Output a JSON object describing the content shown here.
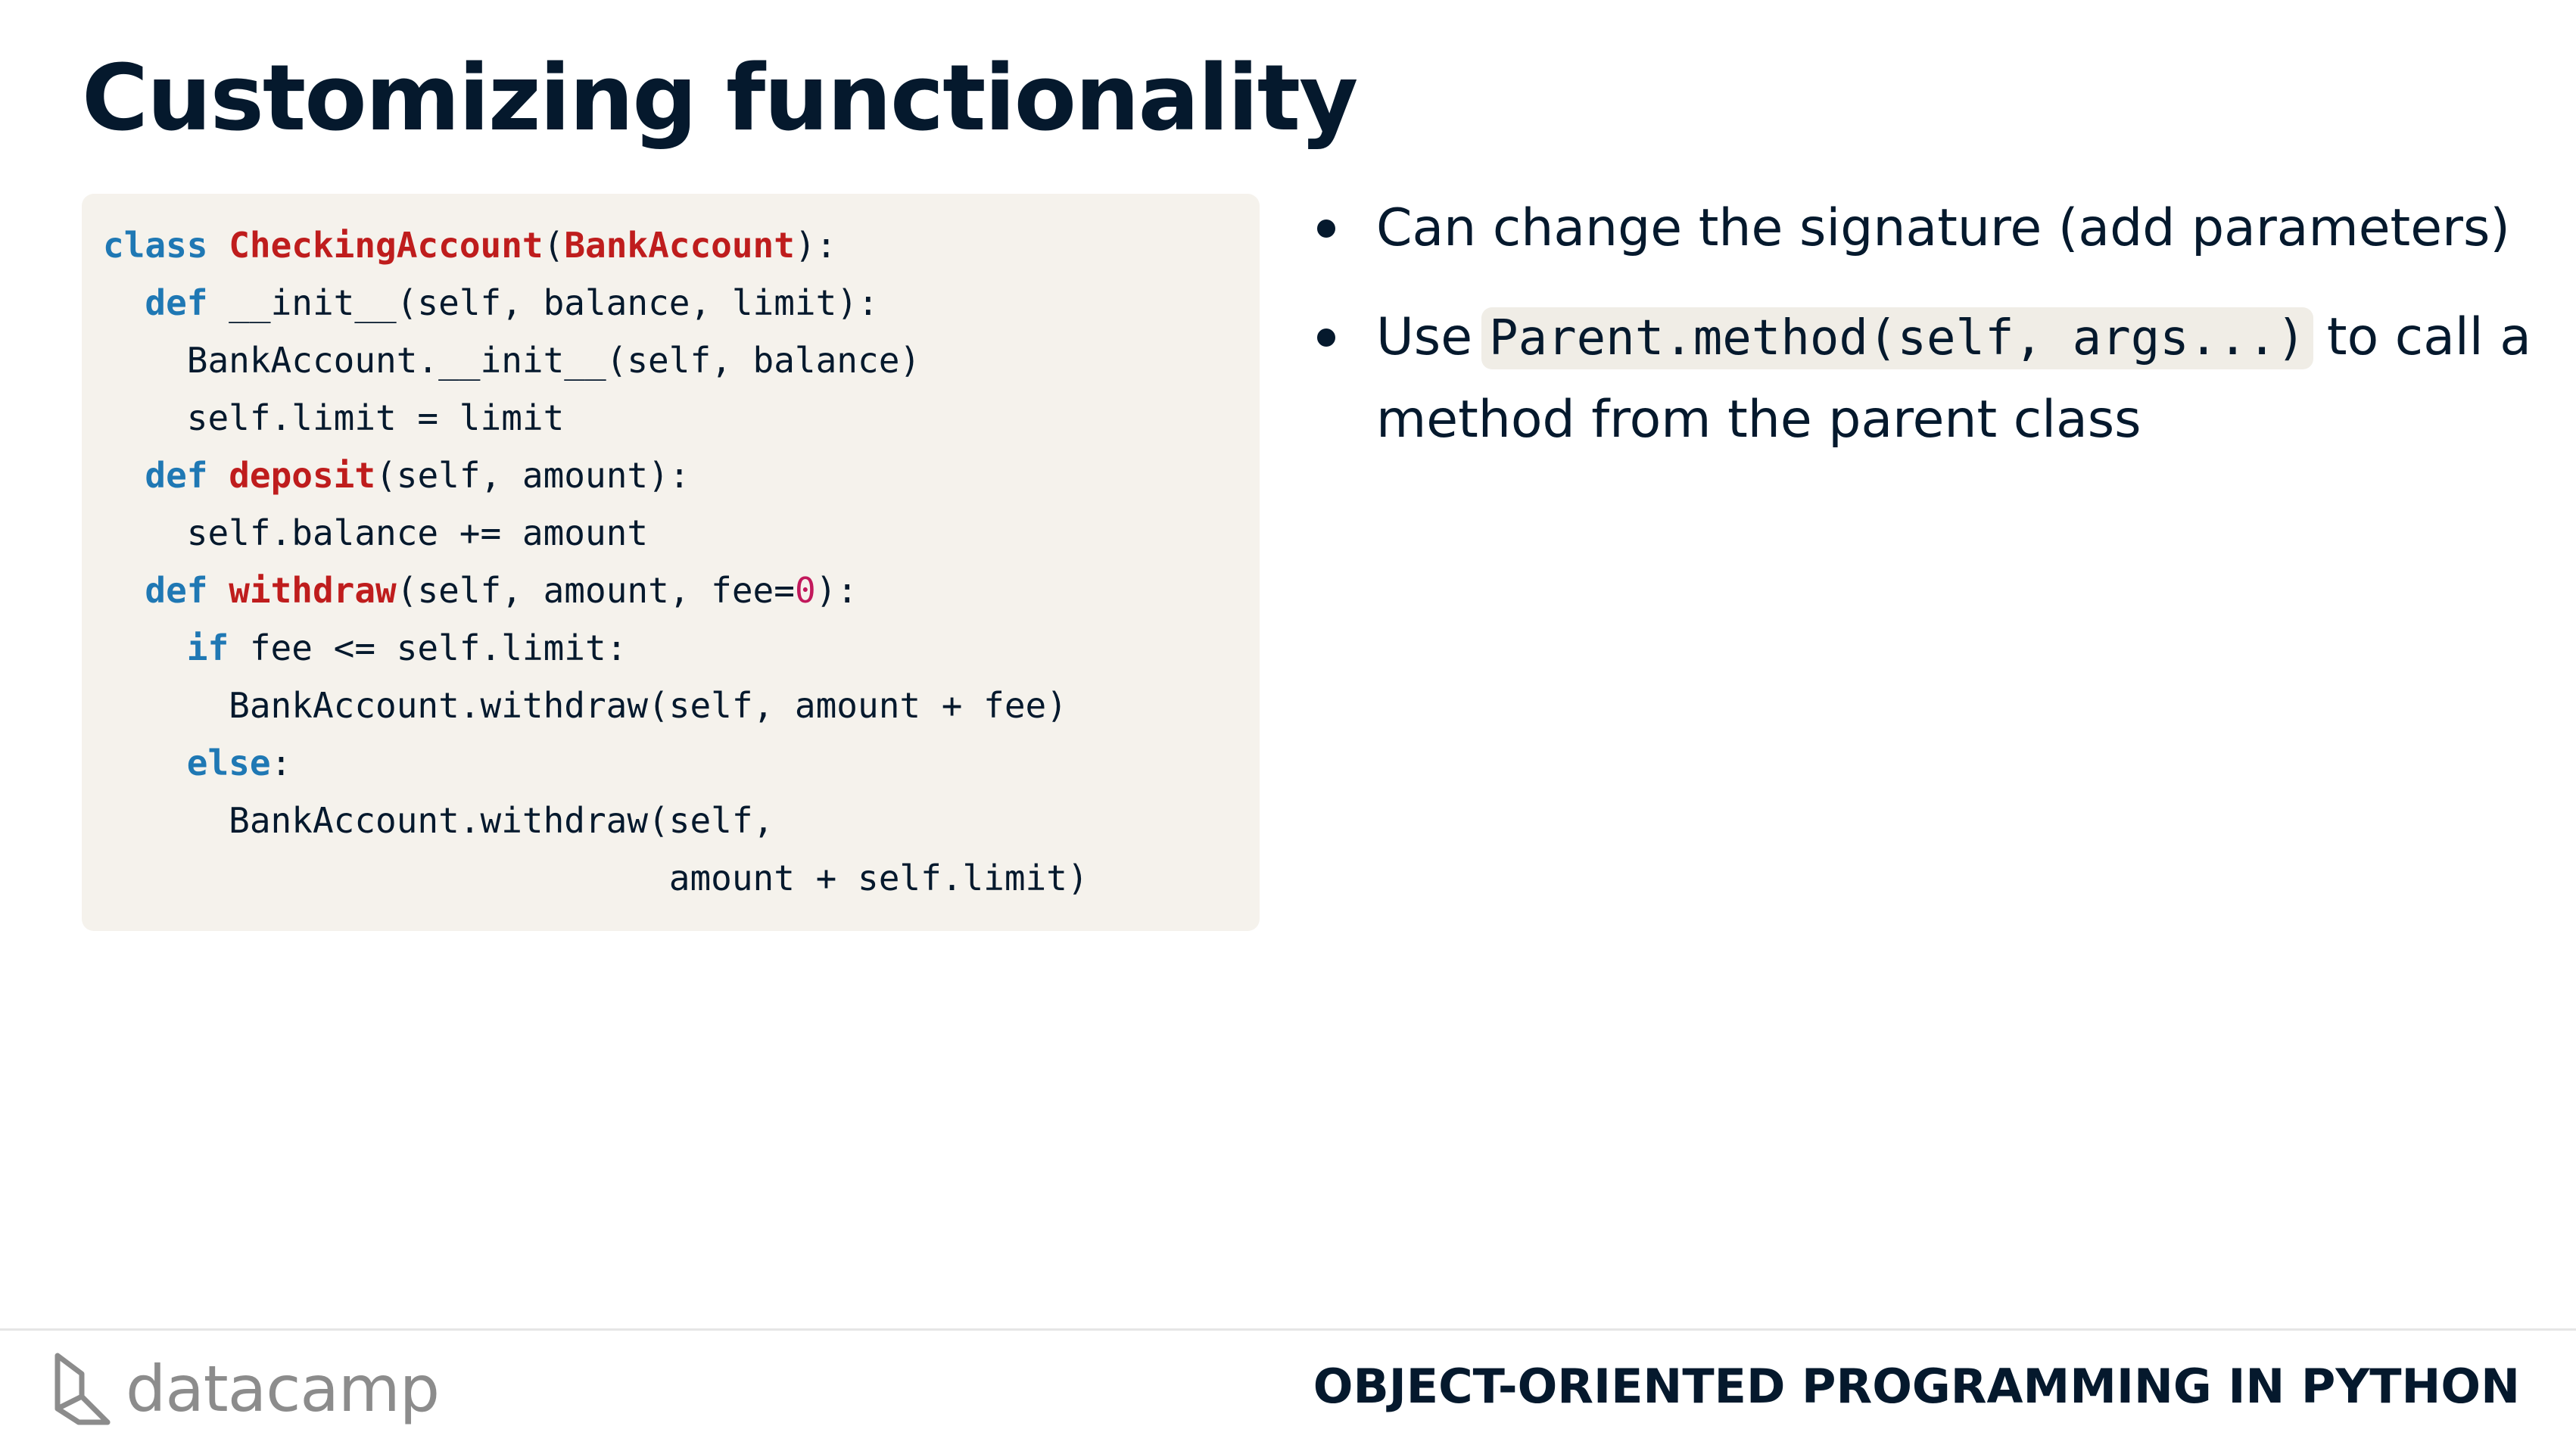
{
  "slide": {
    "title": "Customizing functionality"
  },
  "code": {
    "lines": [
      [
        {
          "t": "class",
          "c": "kw"
        },
        {
          "t": " ",
          "c": ""
        },
        {
          "t": "CheckingAccount",
          "c": "fn"
        },
        {
          "t": "(",
          "c": ""
        },
        {
          "t": "BankAccount",
          "c": "fn"
        },
        {
          "t": "):",
          "c": ""
        }
      ],
      [
        {
          "t": "  ",
          "c": ""
        },
        {
          "t": "def",
          "c": "kw"
        },
        {
          "t": " __init__(self, balance, limit):",
          "c": ""
        }
      ],
      [
        {
          "t": "    BankAccount.__init__(self, balance)",
          "c": ""
        }
      ],
      [
        {
          "t": "    self.limit = limit",
          "c": ""
        }
      ],
      [
        {
          "t": "  ",
          "c": ""
        },
        {
          "t": "def",
          "c": "kw"
        },
        {
          "t": " ",
          "c": ""
        },
        {
          "t": "deposit",
          "c": "fn"
        },
        {
          "t": "(self, amount):",
          "c": ""
        }
      ],
      [
        {
          "t": "    self.balance += amount",
          "c": ""
        }
      ],
      [
        {
          "t": "  ",
          "c": ""
        },
        {
          "t": "def",
          "c": "kw"
        },
        {
          "t": " ",
          "c": ""
        },
        {
          "t": "withdraw",
          "c": "fn"
        },
        {
          "t": "(self, amount, fee=",
          "c": ""
        },
        {
          "t": "0",
          "c": "num"
        },
        {
          "t": "):",
          "c": ""
        }
      ],
      [
        {
          "t": "    ",
          "c": ""
        },
        {
          "t": "if",
          "c": "kw"
        },
        {
          "t": " fee <= self.limit:",
          "c": ""
        }
      ],
      [
        {
          "t": "      BankAccount.withdraw(self, amount + fee)",
          "c": ""
        }
      ],
      [
        {
          "t": "    ",
          "c": ""
        },
        {
          "t": "else",
          "c": "kw"
        },
        {
          "t": ":",
          "c": ""
        }
      ],
      [
        {
          "t": "      BankAccount.withdraw(self,",
          "c": ""
        }
      ],
      [
        {
          "t": "                           amount + self.limit)",
          "c": ""
        }
      ]
    ]
  },
  "bullets": [
    {
      "before": "Can change the signature (add parameters)",
      "code": "",
      "after": ""
    },
    {
      "before": "Use",
      "code": "Parent.method(self, args...)",
      "after": "to call a method from the parent class"
    }
  ],
  "footer": {
    "logo_text": "datacamp",
    "logo_icon": "datacamp-logo-icon",
    "course_title": "OBJECT-ORIENTED PROGRAMMING IN PYTHON"
  },
  "colors": {
    "text": "#05192d",
    "keyword": "#1f78b4",
    "name": "#bf1d1d",
    "number": "#c2185b",
    "code_bg": "#f5f2ec"
  }
}
